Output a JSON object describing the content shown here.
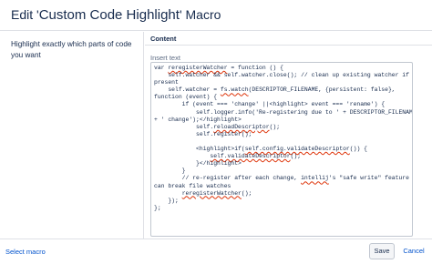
{
  "dialog": {
    "title_prefix": "Edit '",
    "title_name": "Custom Code Highlight",
    "title_suffix": "' Macro"
  },
  "left": {
    "description": "Highlight exactly which parts of code you want"
  },
  "content": {
    "section_title": "Content",
    "field_label": "Insert text",
    "code_lines": [
      [
        {
          "t": "var "
        },
        {
          "t": "reregisterWatcher",
          "sq": true
        },
        {
          "t": " = function () {"
        }
      ],
      [
        {
          "t": "    self.watcher && self.watcher.close(); // clean up existing watcher if"
        }
      ],
      [
        {
          "t": "present"
        }
      ],
      [
        {
          "t": "    self.watcher = "
        },
        {
          "t": "fs.watch",
          "sq": true
        },
        {
          "t": "(DESCRIPTOR_FILENAME, {persistent: false},"
        }
      ],
      [
        {
          "t": "function (event) {"
        }
      ],
      [
        {
          "t": "        if (event === 'change' ||<highlight> event === 'rename') {"
        }
      ],
      [
        {
          "t": "            self.logger.info('Re-registering due to ' + DESCRIPTOR_FILENAME"
        }
      ],
      [
        {
          "t": "+ ' change');</highlight>"
        }
      ],
      [
        {
          "t": "            self."
        },
        {
          "t": "reloadDescriptor",
          "sq": true
        },
        {
          "t": "();"
        }
      ],
      [
        {
          "t": "            self.register();"
        }
      ],
      [
        {
          "t": ""
        }
      ],
      [
        {
          "t": "            <highlight>if("
        },
        {
          "t": "self.config.validateDescriptor",
          "sq": true
        },
        {
          "t": "()) {"
        }
      ],
      [
        {
          "t": "                "
        },
        {
          "t": "self.validateDescriptor",
          "sq": true
        },
        {
          "t": "();"
        }
      ],
      [
        {
          "t": "            }</highlight>"
        }
      ],
      [
        {
          "t": "        }"
        }
      ],
      [
        {
          "t": "        // re-register after each change, "
        },
        {
          "t": "intellij",
          "sq": true
        },
        {
          "t": "'s \"safe write\" feature"
        }
      ],
      [
        {
          "t": "can break file watches"
        }
      ],
      [
        {
          "t": "        "
        },
        {
          "t": "reregisterWatcher",
          "sq": true
        },
        {
          "t": "();"
        }
      ],
      [
        {
          "t": "    });"
        }
      ],
      [
        {
          "t": "};"
        }
      ]
    ]
  },
  "footer": {
    "select_macro": "Select macro",
    "save": "Save",
    "cancel": "Cancel"
  },
  "colors": {
    "link": "#0052cc",
    "spellcheck": "#de350b",
    "border": "#dfe1e6"
  }
}
